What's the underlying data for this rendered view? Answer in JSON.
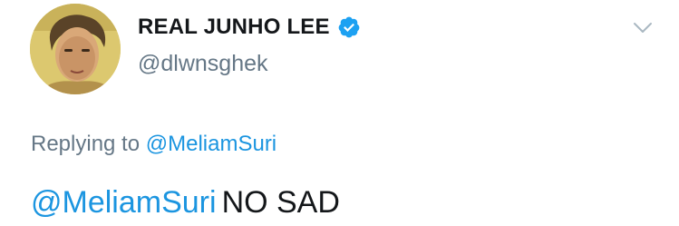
{
  "user": {
    "display_name": "REAL JUNHO LEE",
    "handle": "@dlwnsghek",
    "verified": true
  },
  "reply": {
    "prefix": "Replying to",
    "mention": "@MeliamSuri"
  },
  "tweet": {
    "mention": "@MeliamSuri",
    "text": "NO SAD"
  },
  "icons": {
    "verified": "verified-badge-icon",
    "menu": "chevron-down-icon"
  },
  "colors": {
    "link": "#1b95e0",
    "secondary_text": "#657786",
    "primary_text": "#14171a",
    "verified_badge": "#1da1f2",
    "avatar_bg": "#dcc86f"
  }
}
